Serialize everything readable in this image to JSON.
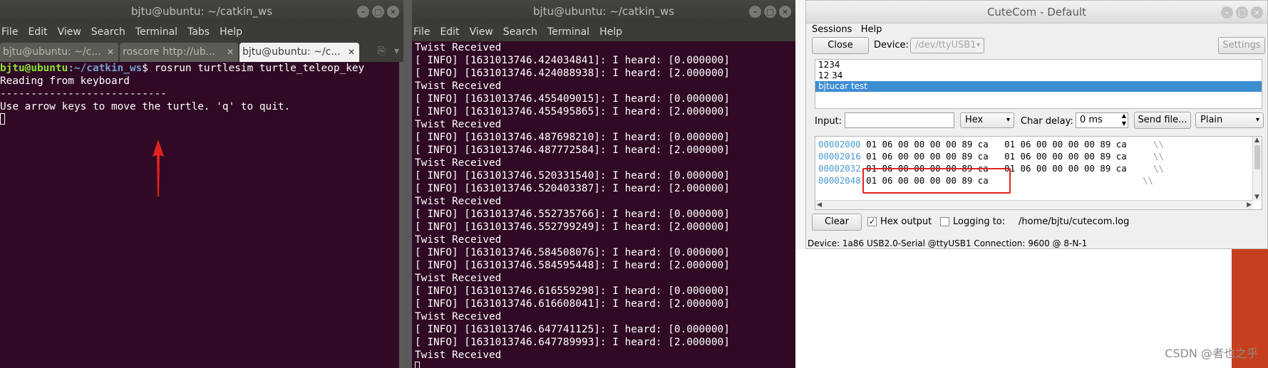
{
  "terminal1": {
    "title": "bjtu@ubuntu: ~/catkin_ws",
    "menu": [
      "File",
      "Edit",
      "View",
      "Search",
      "Terminal",
      "Tabs",
      "Help"
    ],
    "tabs": [
      {
        "label": "bjtu@ubuntu: ~/c..."
      },
      {
        "label": "roscore http://ub..."
      },
      {
        "label": "bjtu@ubuntu: ~/c..."
      }
    ],
    "prompt_user": "bjtu@ubuntu",
    "prompt_path": ":~/catkin_ws",
    "command": "$ rosrun turtlesim turtle_teleop_key",
    "lines": [
      "Reading from keyboard",
      "---------------------------",
      "Use arrow keys to move the turtle. 'q' to quit."
    ]
  },
  "terminal2": {
    "title": "bjtu@ubuntu: ~/catkin_ws",
    "menu": [
      "File",
      "Edit",
      "View",
      "Search",
      "Terminal",
      "Help"
    ],
    "lines": [
      "Twist Received",
      "[ INFO] [1631013746.424034841]: I heard: [0.000000]",
      "[ INFO] [1631013746.424088938]: I heard: [2.000000]",
      "Twist Received",
      "[ INFO] [1631013746.455409015]: I heard: [0.000000]",
      "[ INFO] [1631013746.455495865]: I heard: [2.000000]",
      "Twist Received",
      "[ INFO] [1631013746.487698210]: I heard: [0.000000]",
      "[ INFO] [1631013746.487772584]: I heard: [2.000000]",
      "Twist Received",
      "[ INFO] [1631013746.520331540]: I heard: [0.000000]",
      "[ INFO] [1631013746.520403387]: I heard: [2.000000]",
      "Twist Received",
      "[ INFO] [1631013746.552735766]: I heard: [0.000000]",
      "[ INFO] [1631013746.552799249]: I heard: [2.000000]",
      "Twist Received",
      "[ INFO] [1631013746.584508076]: I heard: [0.000000]",
      "[ INFO] [1631013746.584595448]: I heard: [2.000000]",
      "Twist Received",
      "[ INFO] [1631013746.616559298]: I heard: [0.000000]",
      "[ INFO] [1631013746.616608041]: I heard: [2.000000]",
      "Twist Received",
      "[ INFO] [1631013746.647741125]: I heard: [0.000000]",
      "[ INFO] [1631013746.647789993]: I heard: [2.000000]",
      "Twist Received"
    ]
  },
  "cutecom": {
    "title": "CuteCom - Default",
    "menu": [
      "Sessions",
      "Help"
    ],
    "close_label": "Close",
    "device_label": "Device:",
    "device_value": "/dev/ttyUSB1",
    "settings_label": "Settings",
    "history": [
      "1234",
      "12 34",
      "bjtucar test"
    ],
    "input_label": "Input:",
    "input_value": "",
    "format_value": "Hex",
    "char_delay_label": "Char delay:",
    "char_delay_value": "0 ms",
    "send_file_label": "Send file...",
    "line_end_value": "Plain",
    "output_rows": [
      {
        "addr": "00002000",
        "hex": "01 06 00 00 00 00 89 ca   01 06 00 00 00 00 89 ca",
        "ascii": "\\\\"
      },
      {
        "addr": "00002016",
        "hex": "01 06 00 00 00 00 89 ca   01 06 00 00 00 00 89 ca",
        "ascii": "\\\\"
      },
      {
        "addr": "00002032",
        "hex": "01 06 00 00 00 00 89 ca   01 06 00 00 00 00 89 ca",
        "ascii": "\\\\"
      },
      {
        "addr": "00002048",
        "hex": "01 06 00 00 00 00 89 ca",
        "ascii": "\\\\"
      }
    ],
    "clear_label": "Clear",
    "hex_output_label": "Hex output",
    "hex_output_checked": "✓",
    "logging_label": "Logging to:",
    "log_path": "/home/bjtu/cutecom.log",
    "status_device_label": "Device:",
    "status_device_value": "1a86 USB2.0-Serial @ttyUSB1",
    "status_connection_label": "Connection:",
    "status_connection_value": "9600 @ 8-N-1"
  },
  "watermark": "CSDN @者也之乎",
  "colors": {
    "terminal_bg": "#300a24",
    "annotation_red": "#e3221f",
    "selection_blue": "#3d8dd3"
  }
}
